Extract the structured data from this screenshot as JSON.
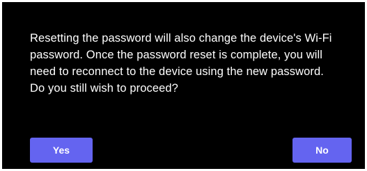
{
  "dialog": {
    "message": "Resetting the password will also change the device's Wi-Fi\npassword. Once the password reset is complete, you will\nneed to reconnect to the device using the new password.\nDo you still wish to proceed?",
    "yes_label": "Yes",
    "no_label": "No"
  },
  "colors": {
    "dialog_background": "#000000",
    "text": "#ffffff",
    "button_accent": "#6464f0"
  }
}
